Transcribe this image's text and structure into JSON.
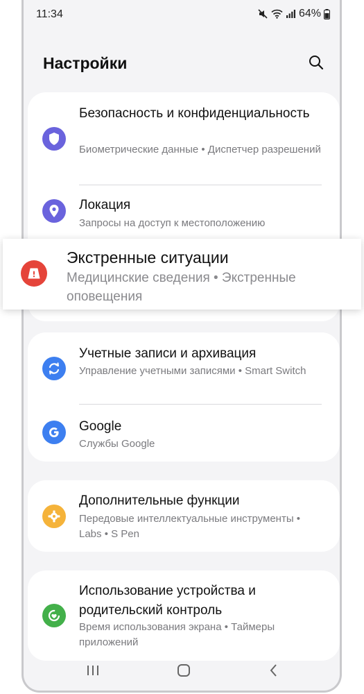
{
  "status_bar": {
    "time": "11:34",
    "battery": "64%"
  },
  "header": {
    "title": "Настройки",
    "search_icon": "search-icon"
  },
  "cards": [
    {
      "items": [
        {
          "title": "Безопасность и конфиденциальность",
          "subtitle": "Биометрические данные • Диспетчер разрешений",
          "icon": "shield-icon",
          "color": "#6a63dd"
        },
        {
          "title": "Локация",
          "subtitle": "Запросы на доступ к местоположению",
          "icon": "location-pin-icon",
          "color": "#6a63dd"
        }
      ]
    },
    {
      "items": [
        {
          "title": "Учетные записи и архивация",
          "subtitle": "Управление учетными записями • Smart Switch",
          "icon": "sync-icon",
          "color": "#3d7ff0"
        },
        {
          "title": "Google",
          "subtitle": "Службы Google",
          "icon": "google-icon",
          "color": "#3d7ff0"
        }
      ]
    },
    {
      "items": [
        {
          "title": "Дополнительные функции",
          "subtitle": "Передовые интеллектуальные инструменты • Labs • S Pen",
          "icon": "puzzle-gear-icon",
          "color": "#f5b33a"
        }
      ]
    },
    {
      "items": [
        {
          "title": "Использование устройства и родительский контроль",
          "subtitle": "Время использования экрана • Таймеры приложений",
          "icon": "wellbeing-icon",
          "color": "#43b04a"
        }
      ]
    }
  ],
  "highlight": {
    "title": "Экстренные ситуации",
    "subtitle": "Медицинские сведения • Экстренные оповещения",
    "icon": "emergency-alert-icon",
    "color": "#e5443a"
  },
  "nav_bar": {
    "recent_icon": "recent-apps-icon",
    "home_icon": "home-icon",
    "back_icon": "back-icon"
  }
}
